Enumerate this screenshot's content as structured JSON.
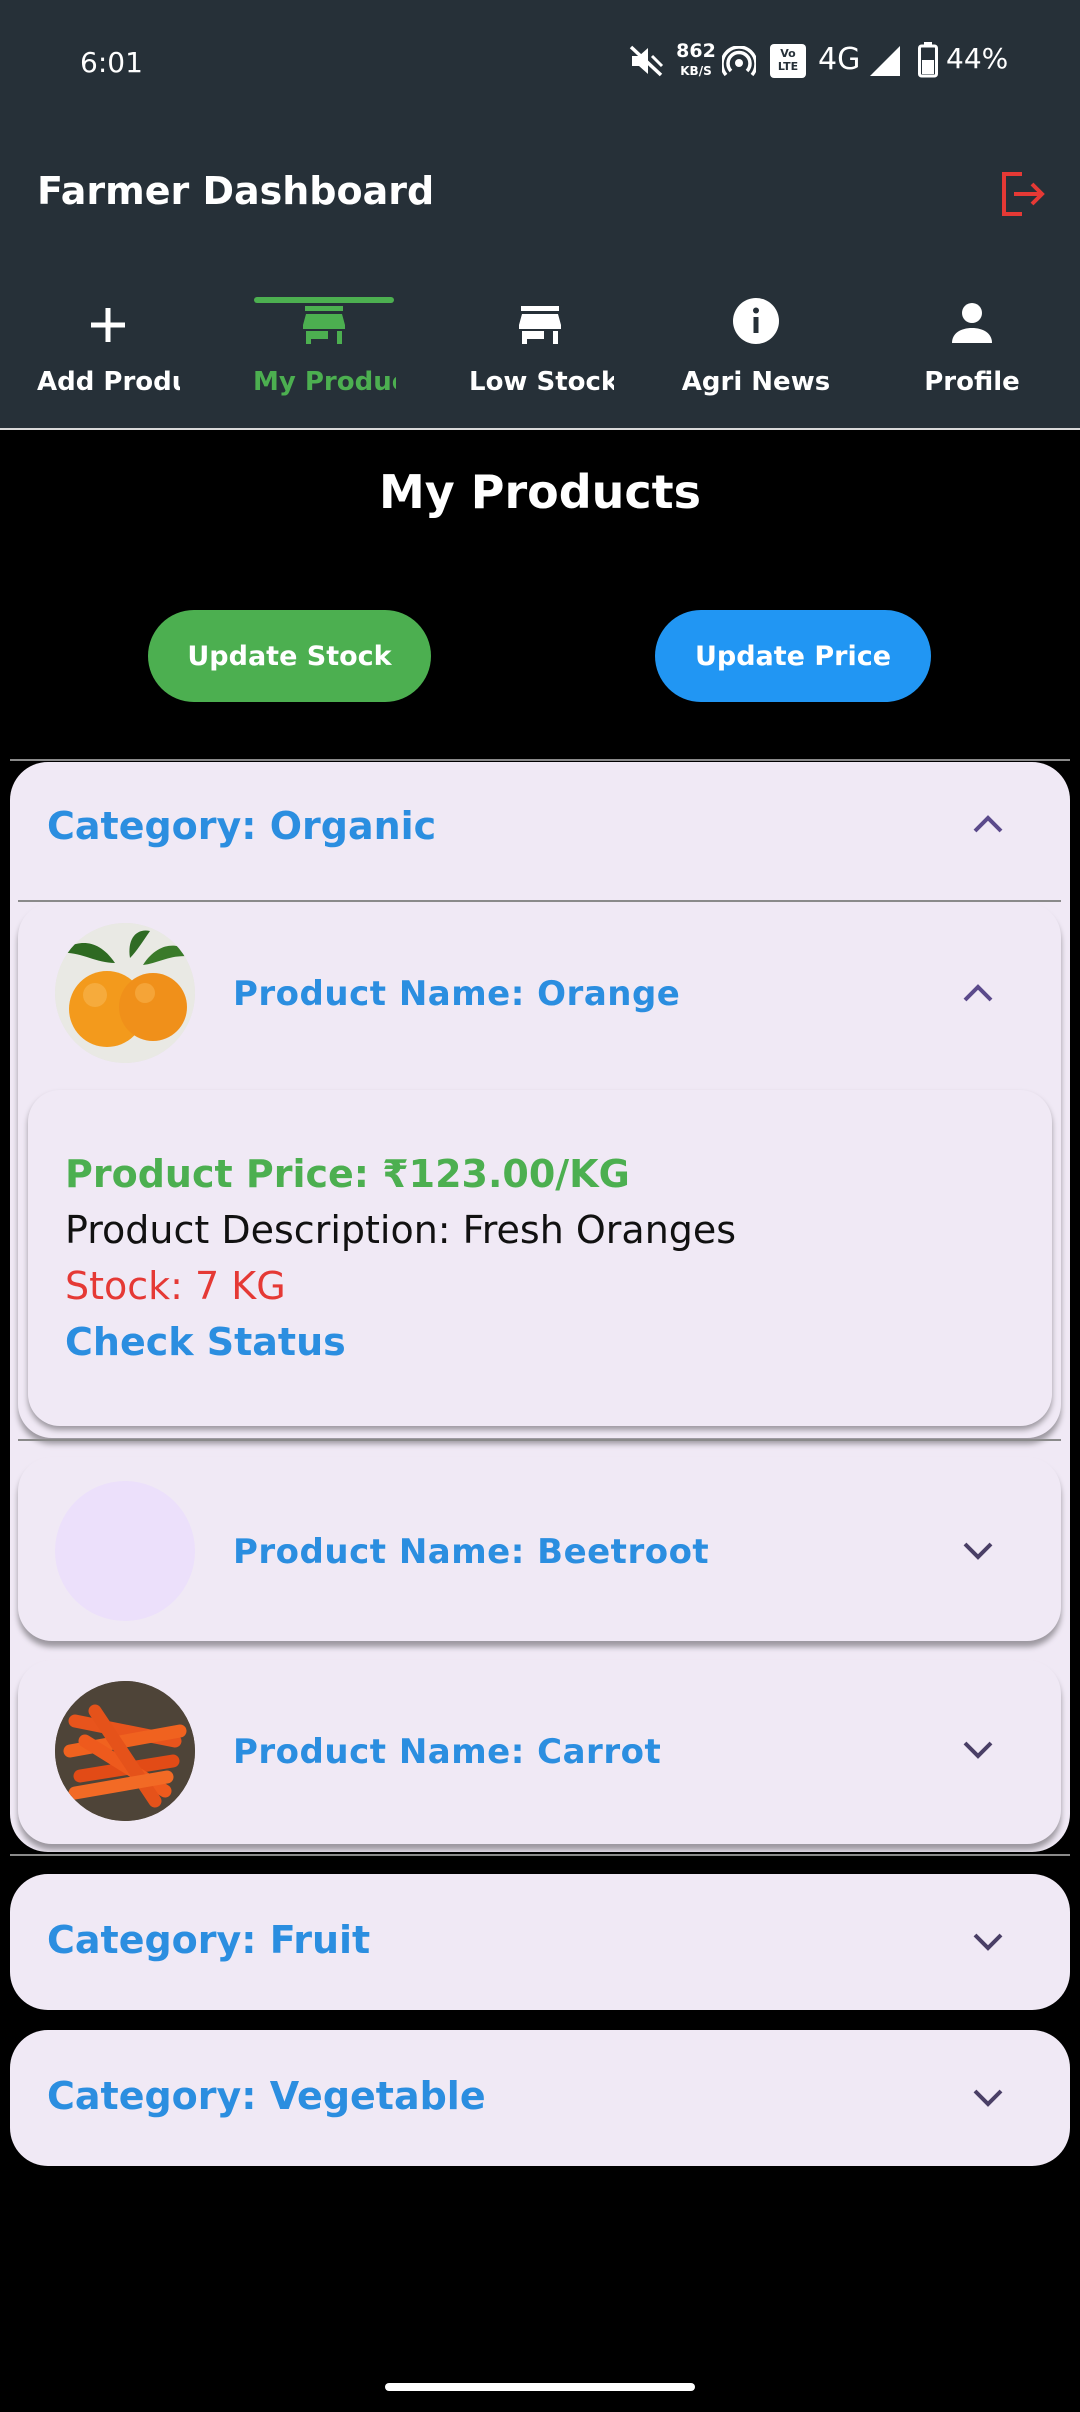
{
  "status_bar": {
    "time": "6:01",
    "net_speed_value": "862",
    "net_speed_unit": "KB/S",
    "volte": "Vo LTE",
    "network": "4G",
    "battery": "44%",
    "icons": [
      "mute-icon",
      "hotspot-icon",
      "volte-icon",
      "signal-icon",
      "battery-icon"
    ]
  },
  "app_bar": {
    "title": "Farmer Dashboard",
    "logout_icon": "logout-icon",
    "logout_color": "#e53935"
  },
  "tabs": [
    {
      "label": "Add Product",
      "icon": "plus-icon",
      "active": false
    },
    {
      "label": "My Products",
      "icon": "store-icon",
      "active": true
    },
    {
      "label": "Low Stock Products",
      "icon": "store-icon",
      "active": false
    },
    {
      "label": "Agri News",
      "icon": "info-icon",
      "active": false
    },
    {
      "label": "Profile",
      "icon": "person-icon",
      "active": false
    }
  ],
  "page": {
    "title": "My Products",
    "update_stock_label": "Update Stock",
    "update_price_label": "Update Price"
  },
  "categories": [
    {
      "label": "Category: Organic",
      "expanded": true,
      "products": [
        {
          "name": "Product Name: Orange",
          "expanded": true,
          "price": "Product Price: ₹123.00/KG",
          "description": "Product Description: Fresh Oranges",
          "stock": "Stock: 7 KG",
          "check_status": "Check Status"
        },
        {
          "name": "Product Name: Beetroot",
          "expanded": false
        },
        {
          "name": "Product Name: Carrot",
          "expanded": false
        }
      ]
    },
    {
      "label": "Category: Fruit",
      "expanded": false
    },
    {
      "label": "Category: Vegetable",
      "expanded": false
    }
  ],
  "colors": {
    "appbar_bg": "#263038",
    "accent_green": "#4caf50",
    "accent_blue": "#2196f3",
    "link_blue": "#2b8ee0",
    "stock_red": "#e53935",
    "card_bg": "#f0e9f5",
    "chevron": "#5b4a8b"
  }
}
